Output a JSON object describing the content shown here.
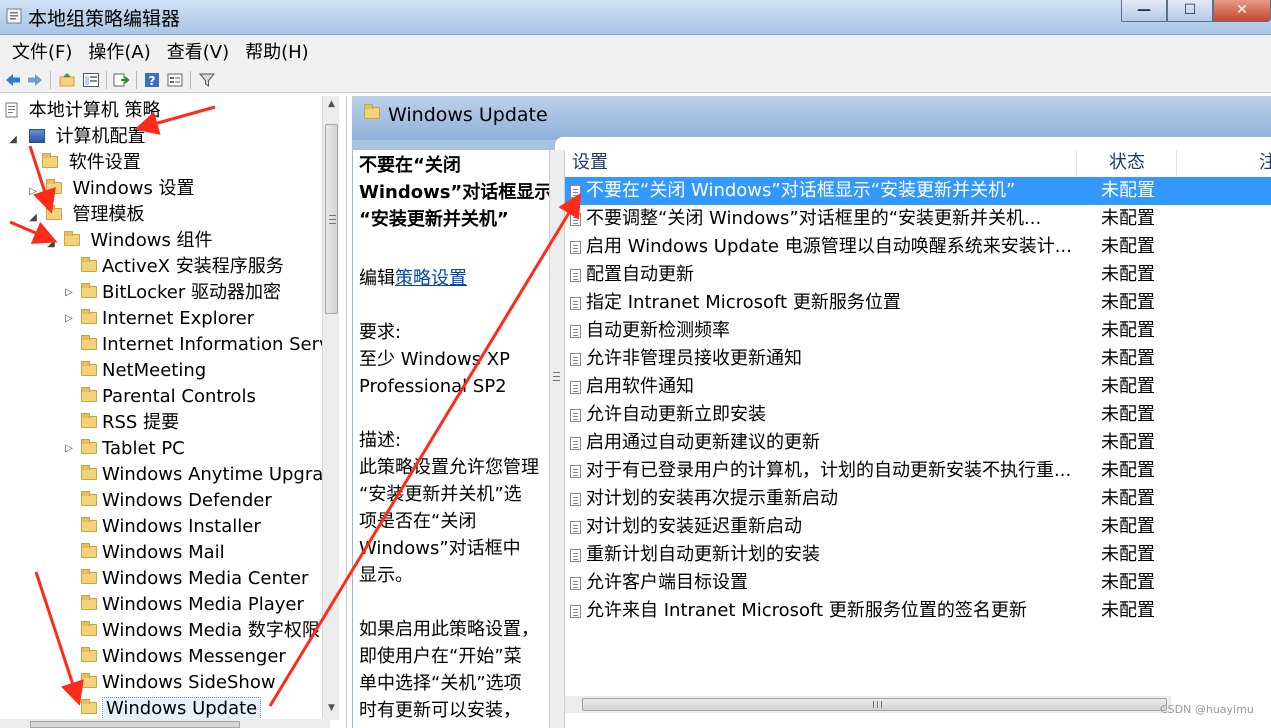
{
  "window": {
    "title": "本地组策略编辑器"
  },
  "menu": [
    "文件(F)",
    "操作(A)",
    "查看(V)",
    "帮助(H)"
  ],
  "toolbar_icons": [
    "back-icon",
    "forward-icon",
    "up-folder-icon",
    "show-hide-tree-icon",
    "export-list-icon",
    "help-icon",
    "properties-icon",
    "filter-icon"
  ],
  "tree": {
    "root": "本地计算机 策略",
    "computer_config": "计算机配置",
    "software_settings": "软件设置",
    "windows_settings": "Windows 设置",
    "admin_templates": "管理模板",
    "windows_components": "Windows 组件",
    "components": [
      "ActiveX 安装程序服务",
      "BitLocker 驱动器加密",
      "Internet Explorer",
      "Internet Information Servi",
      "NetMeeting",
      "Parental Controls",
      "RSS 提要",
      "Tablet PC",
      "Windows Anytime Upgrac",
      "Windows Defender",
      "Windows Installer",
      "Windows Mail",
      "Windows Media Center",
      "Windows Media Player",
      "Windows Media 数字权限",
      "Windows Messenger",
      "Windows SideShow",
      "Windows Update"
    ]
  },
  "header": {
    "title": "Windows Update"
  },
  "description": {
    "title_lines": [
      "不要在“关闭",
      "Windows”对话框显示",
      "“安装更新并关机”"
    ],
    "edit_prefix": "编辑",
    "edit_link": "策略设置",
    "req_label": "要求:",
    "req_lines": [
      "至少 Windows XP",
      "Professional SP2"
    ],
    "desc_label": "描述:",
    "desc_lines": [
      "此策略设置允许您管理",
      "“安装更新并关机”选",
      "项是否在“关闭",
      "Windows”对话框中",
      "显示。"
    ],
    "more_lines": [
      "如果启用此策略设置，",
      "即使用户在“开始”菜",
      "单中选择“关机”选项",
      "时有更新可以安装，"
    ]
  },
  "list": {
    "columns": [
      "设置",
      "状态",
      "注"
    ],
    "rows": [
      {
        "name": "不要在“关闭 Windows”对话框显示“安装更新并关机”",
        "state": "未配置"
      },
      {
        "name": "不要调整“关闭 Windows”对话框里的“安装更新并关机...",
        "state": "未配置"
      },
      {
        "name": "启用 Windows Update 电源管理以自动唤醒系统来安装计...",
        "state": "未配置"
      },
      {
        "name": "配置自动更新",
        "state": "未配置"
      },
      {
        "name": "指定 Intranet Microsoft 更新服务位置",
        "state": "未配置"
      },
      {
        "name": "自动更新检测频率",
        "state": "未配置"
      },
      {
        "name": "允许非管理员接收更新通知",
        "state": "未配置"
      },
      {
        "name": "启用软件通知",
        "state": "未配置"
      },
      {
        "name": "允许自动更新立即安装",
        "state": "未配置"
      },
      {
        "name": "启用通过自动更新建议的更新",
        "state": "未配置"
      },
      {
        "name": "对于有已登录用户的计算机，计划的自动更新安装不执行重...",
        "state": "未配置"
      },
      {
        "name": "对计划的安装再次提示重新启动",
        "state": "未配置"
      },
      {
        "name": "对计划的安装延迟重新启动",
        "state": "未配置"
      },
      {
        "name": "重新计划自动更新计划的安装",
        "state": "未配置"
      },
      {
        "name": "允许客户端目标设置",
        "state": "未配置"
      },
      {
        "name": "允许来自 Intranet Microsoft 更新服务位置的签名更新",
        "state": "未配置"
      }
    ]
  },
  "watermark": "CSDN @huayimu",
  "colors": {
    "selection": "#3399ff",
    "header_band": "#a9c4e4",
    "annotation_arrow": "#ff2a1a"
  }
}
